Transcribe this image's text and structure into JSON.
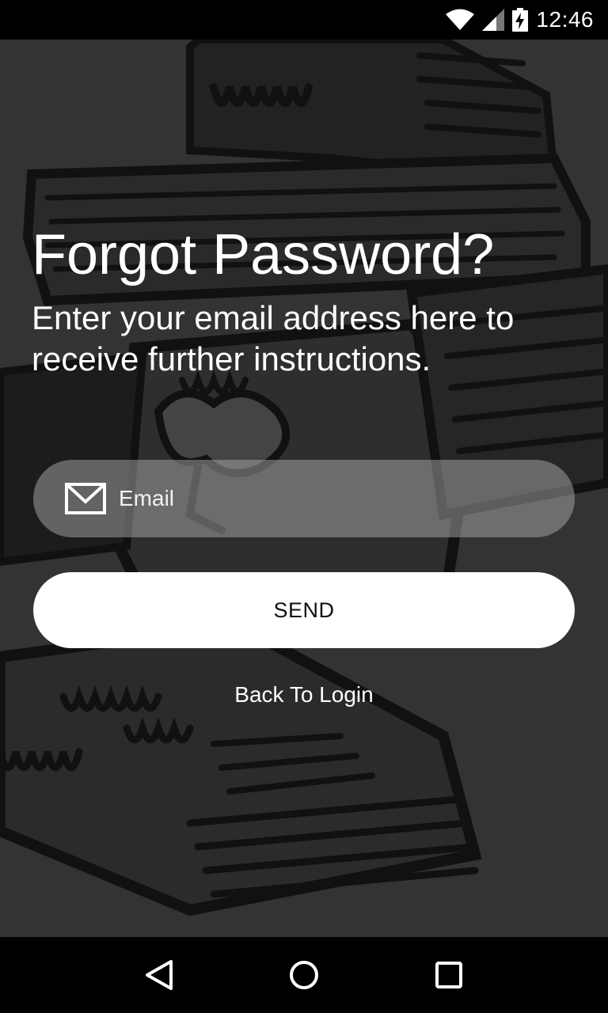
{
  "status_bar": {
    "time": "12:46",
    "icons": [
      "wifi-icon",
      "cell-signal-icon",
      "battery-charging-icon"
    ]
  },
  "main": {
    "title": "Forgot Password?",
    "subtitle": "Enter your email address here to receive further instructions.",
    "email_field": {
      "placeholder": "Email",
      "value": "",
      "icon": "mail-icon"
    },
    "send_label": "SEND",
    "back_link": "Back To Login"
  },
  "nav_bar": {
    "buttons": [
      "back-triangle-icon",
      "home-circle-icon",
      "recents-square-icon"
    ]
  },
  "colors": {
    "background": "#333333",
    "field": "#aaaaaa80",
    "button": "#ffffff",
    "bars": "#000000"
  }
}
